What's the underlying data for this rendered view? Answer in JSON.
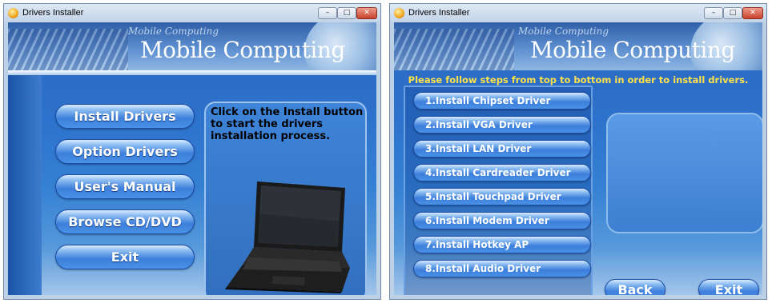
{
  "left_window": {
    "title": "Drivers Installer",
    "banner": {
      "brand_small": "Mobile Computing",
      "brand_big": "Mobile Computing"
    },
    "menu": [
      "Install Drivers",
      "Option Drivers",
      "User's Manual",
      "Browse CD/DVD",
      "Exit"
    ],
    "instruction": "Click on the Install button to start the drivers installation process."
  },
  "right_window": {
    "title": "Drivers Installer",
    "banner": {
      "brand_small": "Mobile Computing",
      "brand_big": "Mobile Computing"
    },
    "instruction": "Please follow steps from top to bottom in order to install drivers.",
    "steps": [
      "1.Install Chipset Driver",
      "2.Install VGA Driver",
      "3.Install LAN Driver",
      "4.Install Cardreader Driver",
      "5.Install Touchpad Driver",
      "6.Install Modem Driver",
      "7.Install Hotkey AP",
      "8.Install Audio Driver"
    ],
    "back_label": "Back",
    "exit_label": "Exit"
  },
  "window_controls": {
    "minimize": "–",
    "maximize": "□",
    "close": "✕"
  },
  "icons": {
    "app": "app-icon",
    "laptop": "laptop-illustration"
  },
  "colors": {
    "accent_blue": "#2d72cc",
    "button_blue": "#3d7fdb",
    "steps_title_yellow": "#ffe24a"
  }
}
